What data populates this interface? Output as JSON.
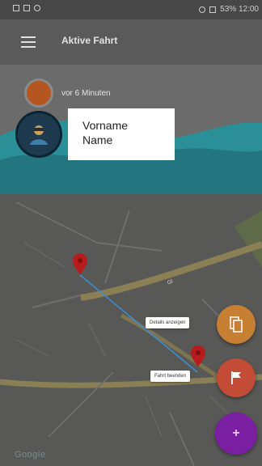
{
  "statusbar": {
    "status_text": "53% 12:00"
  },
  "appbar": {
    "title": "Aktive Fahrt"
  },
  "header": {
    "time_ago": "vor 6 Minuten",
    "first_name": "Vorname",
    "last_name": "Name"
  },
  "map": {
    "street_label": "Gl",
    "attribution": "Google"
  },
  "fab": {
    "label_top": "Details anzeigen",
    "label_middle": "Fahrt beenden",
    "main_symbol": "+"
  },
  "colors": {
    "accent_teal": "#2a8f97",
    "fab_orange": "#c77f33",
    "fab_red": "#c24c35",
    "fab_purple": "#7b1fa2",
    "pin_red": "#b71c1c"
  },
  "icons": {
    "menu": "menu-icon",
    "document": "document-icon",
    "flag": "flag-icon",
    "map_pin": "map-pin-icon",
    "person": "person-icon"
  }
}
